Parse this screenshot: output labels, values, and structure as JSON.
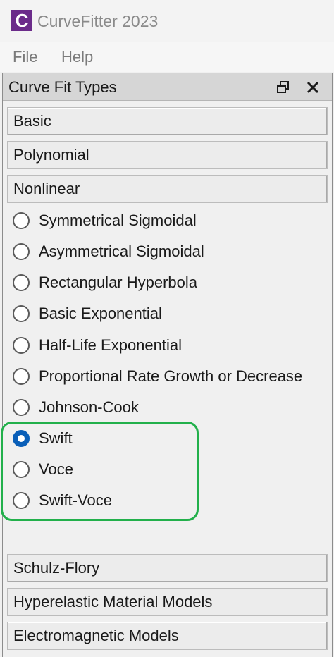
{
  "app": {
    "icon_letter": "C",
    "title": "CurveFitter 2023"
  },
  "menu": {
    "items": [
      "File",
      "Help"
    ]
  },
  "panel": {
    "title": "Curve Fit Types",
    "restore_icon": "restore-window-icon",
    "close_icon": "close-icon"
  },
  "categories_top": [
    {
      "label": "Basic"
    },
    {
      "label": "Polynomial"
    },
    {
      "label": "Nonlinear"
    }
  ],
  "nonlinear_options": [
    {
      "label": "Symmetrical Sigmoidal",
      "selected": false
    },
    {
      "label": "Asymmetrical Sigmoidal",
      "selected": false
    },
    {
      "label": "Rectangular Hyperbola",
      "selected": false
    },
    {
      "label": "Basic Exponential",
      "selected": false
    },
    {
      "label": "Half-Life Exponential",
      "selected": false
    },
    {
      "label": "Proportional Rate Growth or Decrease",
      "selected": false
    },
    {
      "label": "Johnson-Cook",
      "selected": false
    },
    {
      "label": "Swift",
      "selected": true
    },
    {
      "label": "Voce",
      "selected": false
    },
    {
      "label": "Swift-Voce",
      "selected": false
    }
  ],
  "categories_bottom": [
    {
      "label": "Schulz-Flory"
    },
    {
      "label": "Hyperelastic Material Models"
    },
    {
      "label": "Electromagnetic Models"
    }
  ],
  "colors": {
    "brand": "#6b2b8a",
    "accent": "#0a5fb8",
    "highlight": "#22b04b"
  }
}
